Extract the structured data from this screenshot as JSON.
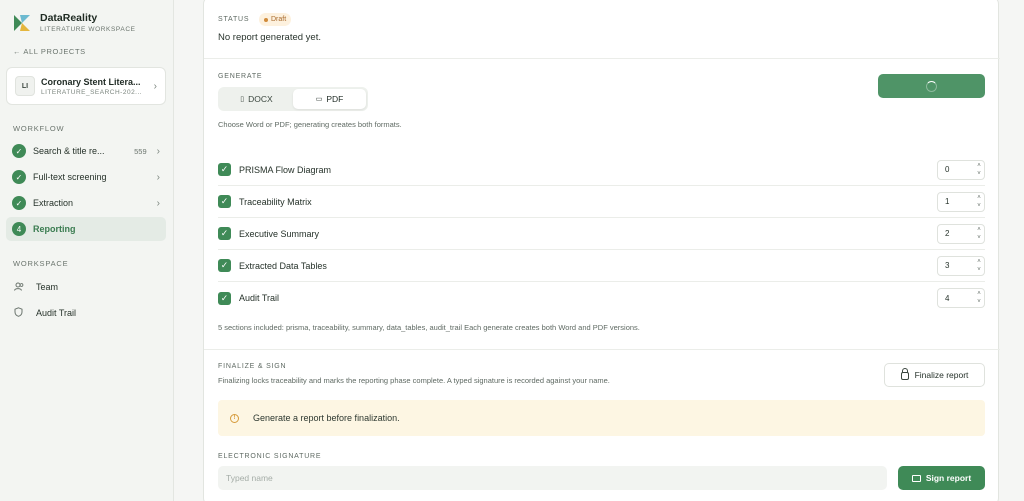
{
  "brand": {
    "name": "DataReality",
    "subtitle": "LITERATURE WORKSPACE"
  },
  "sidebar": {
    "back_label": "← ALL PROJECTS",
    "project": {
      "badge": "LI",
      "title": "Coronary Stent Litera...",
      "subtitle": "LITERATURE_SEARCH-202..."
    },
    "workflow_label": "WORKFLOW",
    "workflow": [
      {
        "label": "Search & title re...",
        "count": "559",
        "state": "done",
        "marker": "✓"
      },
      {
        "label": "Full-text screening",
        "count": "",
        "state": "done",
        "marker": "✓"
      },
      {
        "label": "Extraction",
        "count": "",
        "state": "done",
        "marker": "✓"
      },
      {
        "label": "Reporting",
        "count": "",
        "state": "active",
        "marker": "4"
      }
    ],
    "workspace_label": "WORKSPACE",
    "workspace": [
      {
        "label": "Team",
        "icon": "team-icon"
      },
      {
        "label": "Audit Trail",
        "icon": "shield-icon"
      }
    ]
  },
  "status": {
    "label": "STATUS",
    "badge": "Draft",
    "text": "No report generated yet."
  },
  "generate": {
    "label": "GENERATE",
    "formats": [
      {
        "label": "DOCX",
        "selected": false
      },
      {
        "label": "PDF",
        "selected": true
      }
    ],
    "help": "Choose Word or PDF; generating creates both formats.",
    "button_state": "loading"
  },
  "sections": [
    {
      "label": "PRISMA Flow Diagram",
      "checked": true,
      "order": "0"
    },
    {
      "label": "Traceability Matrix",
      "checked": true,
      "order": "1"
    },
    {
      "label": "Executive Summary",
      "checked": true,
      "order": "2"
    },
    {
      "label": "Extracted Data Tables",
      "checked": true,
      "order": "3"
    },
    {
      "label": "Audit Trail",
      "checked": true,
      "order": "4"
    }
  ],
  "sections_note": "5 sections included: prisma, traceability, summary, data_tables, audit_trail Each generate creates both Word and PDF versions.",
  "finalize": {
    "label": "FINALIZE & SIGN",
    "description": "Finalizing locks traceability and marks the reporting phase complete. A typed signature is recorded against your name.",
    "button": "Finalize report",
    "warning": "Generate a report before finalization."
  },
  "signature": {
    "label": "ELECTRONIC SIGNATURE",
    "placeholder": "Typed name",
    "value": "",
    "button": "Sign report"
  },
  "colors": {
    "accent": "#3f8a57",
    "draft": "#a8692a",
    "warning_bg": "#fdf6e3"
  }
}
